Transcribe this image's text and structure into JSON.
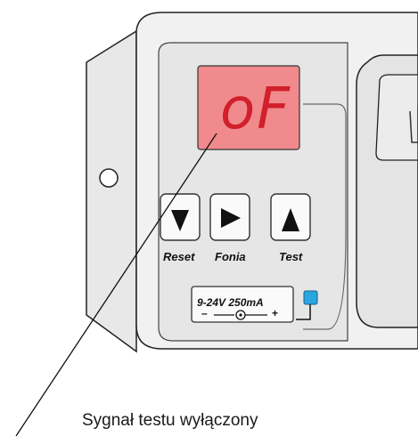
{
  "display": {
    "text": "oF",
    "background": "#f08a8c",
    "digit_color": "#d11f2b"
  },
  "buttons": [
    {
      "label": "Reset",
      "icon": "triangle-down-icon"
    },
    {
      "label": "Fonia",
      "icon": "triangle-right-icon"
    },
    {
      "label": "Test",
      "icon": "triangle-up-icon"
    }
  ],
  "power": {
    "spec": "9-24V 250mA",
    "minus": "–",
    "plus": "+"
  },
  "led": {
    "color": "#2aa7e0"
  },
  "caption": "Sygnał testu wyłączony"
}
